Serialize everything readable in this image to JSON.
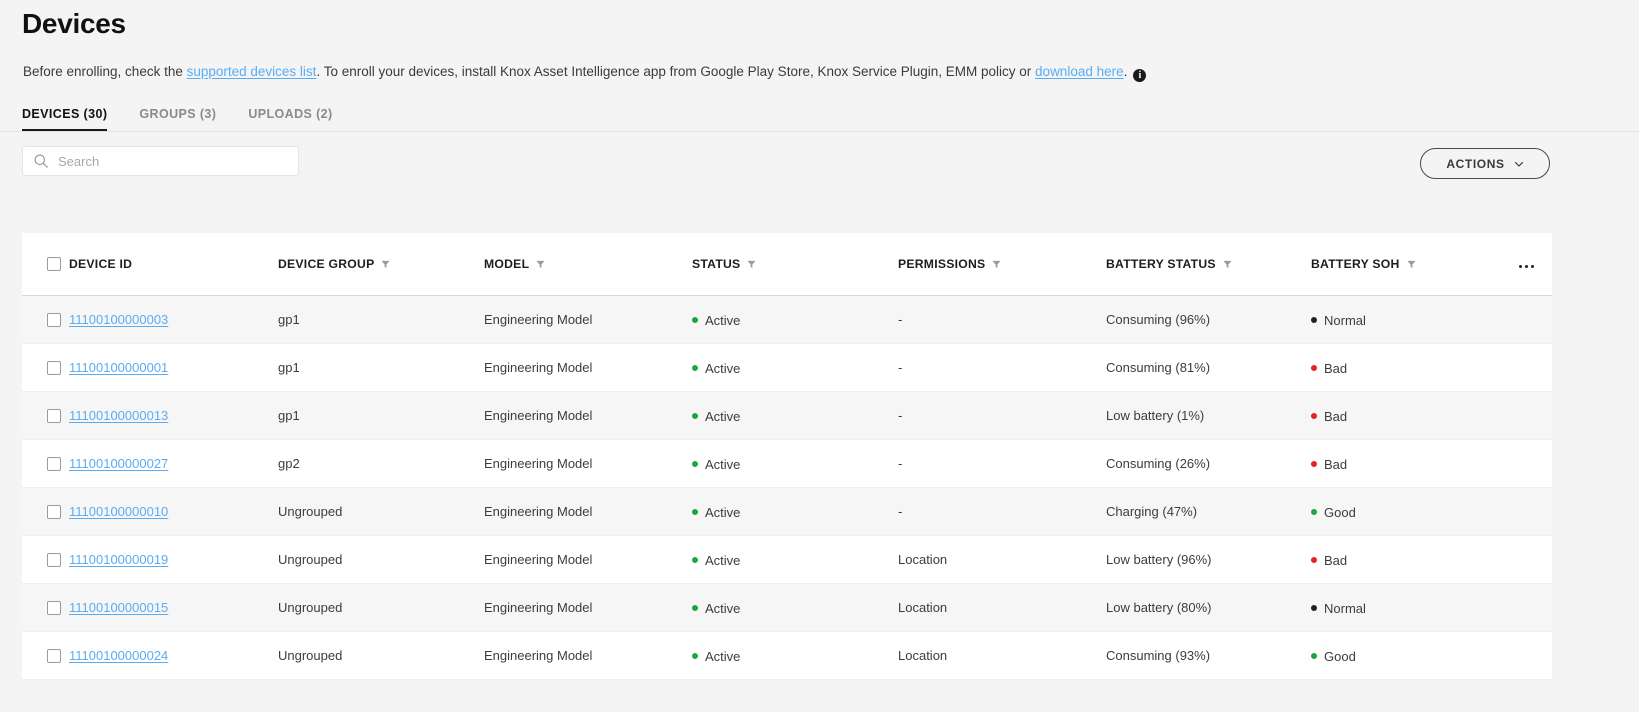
{
  "header": {
    "title": "Devices",
    "description_pre": "Before enrolling, check the ",
    "link1": "supported devices list",
    "description_mid": ". To enroll your devices, install Knox Asset Intelligence app from Google Play Store, Knox Service Plugin, EMM policy or ",
    "link2": "download here",
    "description_post": ".",
    "info_icon": "info-icon"
  },
  "tabs": [
    {
      "label": "DEVICES (30)",
      "active": true
    },
    {
      "label": "GROUPS (3)",
      "active": false
    },
    {
      "label": "UPLOADS (2)",
      "active": false
    }
  ],
  "toolbar": {
    "search_placeholder": "Search",
    "search_value": "",
    "search_icon": "search-icon",
    "actions_label": "ACTIONS",
    "actions_chevron": "chevron-down-icon"
  },
  "table": {
    "columns": [
      {
        "label": "DEVICE ID",
        "filter": false
      },
      {
        "label": "DEVICE GROUP",
        "filter": true
      },
      {
        "label": "MODEL",
        "filter": true
      },
      {
        "label": "STATUS",
        "filter": true
      },
      {
        "label": "PERMISSIONS",
        "filter": true
      },
      {
        "label": "BATTERY STATUS",
        "filter": true
      },
      {
        "label": "BATTERY SOH",
        "filter": true
      }
    ],
    "overflow_icon": "more-options-icon",
    "rows": [
      {
        "device_id": "11100100000003",
        "device_group": "gp1",
        "model": "Engineering Model",
        "status": "Active",
        "status_color": "#1aa34a",
        "permissions": "-",
        "battery_status": "Consuming (96%)",
        "battery_soh": "Normal",
        "soh_color": "#222222"
      },
      {
        "device_id": "11100100000001",
        "device_group": "gp1",
        "model": "Engineering Model",
        "status": "Active",
        "status_color": "#1aa34a",
        "permissions": "-",
        "battery_status": "Consuming (81%)",
        "battery_soh": "Bad",
        "soh_color": "#e8202a"
      },
      {
        "device_id": "11100100000013",
        "device_group": "gp1",
        "model": "Engineering Model",
        "status": "Active",
        "status_color": "#1aa34a",
        "permissions": "-",
        "battery_status": "Low battery (1%)",
        "battery_soh": "Bad",
        "soh_color": "#e8202a"
      },
      {
        "device_id": "11100100000027",
        "device_group": "gp2",
        "model": "Engineering Model",
        "status": "Active",
        "status_color": "#1aa34a",
        "permissions": "-",
        "battery_status": "Consuming (26%)",
        "battery_soh": "Bad",
        "soh_color": "#e8202a"
      },
      {
        "device_id": "11100100000010",
        "device_group": "Ungrouped",
        "model": "Engineering Model",
        "status": "Active",
        "status_color": "#1aa34a",
        "permissions": "-",
        "battery_status": "Charging (47%)",
        "battery_soh": "Good",
        "soh_color": "#1aa34a"
      },
      {
        "device_id": "11100100000019",
        "device_group": "Ungrouped",
        "model": "Engineering Model",
        "status": "Active",
        "status_color": "#1aa34a",
        "permissions": "Location",
        "battery_status": "Low battery (96%)",
        "battery_soh": "Bad",
        "soh_color": "#e8202a"
      },
      {
        "device_id": "11100100000015",
        "device_group": "Ungrouped",
        "model": "Engineering Model",
        "status": "Active",
        "status_color": "#1aa34a",
        "permissions": "Location",
        "battery_status": "Low battery (80%)",
        "battery_soh": "Normal",
        "soh_color": "#222222"
      },
      {
        "device_id": "11100100000024",
        "device_group": "Ungrouped",
        "model": "Engineering Model",
        "status": "Active",
        "status_color": "#1aa34a",
        "permissions": "Location",
        "battery_status": "Consuming (93%)",
        "battery_soh": "Good",
        "soh_color": "#1aa34a"
      }
    ]
  },
  "colors": {
    "link": "#5aacf5",
    "page_bg": "#f4f4f4",
    "row_stripe": "#f6f6f6",
    "accent": "#1a1a1a"
  }
}
